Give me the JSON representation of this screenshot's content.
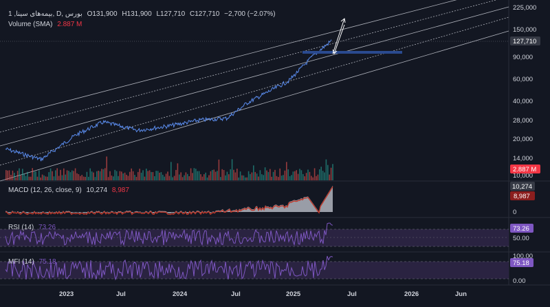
{
  "header": {
    "symbol": "1 ,بیمه‌های سینا, D, بورس",
    "open": "O131,900",
    "high": "H131,900",
    "low": "L127,710",
    "close": "C127,710",
    "change": "−2,700 (−2.07%)",
    "volume_label": "Volume (SMA)",
    "volume_value": "2.887 M"
  },
  "price_axis": {
    "ticks": [
      "225,000",
      "150,000",
      "90,000",
      "60,000",
      "40,000",
      "28,000",
      "20,000",
      "14,000",
      "10,000"
    ],
    "last_price": "127,710",
    "volume_badge": "2.887 M"
  },
  "macd": {
    "label": "MACD (12, 26, close, 9)",
    "value1": "10,274",
    "value2": "8,987",
    "axis_zero": "0",
    "badge1": "10,274",
    "badge2": "8,987"
  },
  "rsi": {
    "label": "RSI (14)",
    "value": "73.26",
    "badge": "73.26",
    "axis_tick": "50.00"
  },
  "mfi": {
    "label": "MFI (14)",
    "value": "75.18",
    "badge": "75.18",
    "axis_top": "100.00",
    "axis_bottom": "0.00"
  },
  "time_axis": [
    "2023",
    "Jul",
    "2024",
    "Jul",
    "2025",
    "Jul",
    "2026",
    "Jun"
  ],
  "colors": {
    "background": "#131722",
    "price_line": "#5b8def",
    "channel": "#b2b5be",
    "macd_fill": "#b2b5be",
    "macd_signal": "#c0392b",
    "oscillator": "#7e57c2",
    "band": "#2a2341",
    "last_price_badge": "#363a45",
    "volume_badge": "#f23645",
    "rsi_badge": "#7e57c2",
    "horizontal_level": "#2a4a8f"
  },
  "chart_data": {
    "type": "line",
    "title": "",
    "xlabel": "",
    "ylabel": "",
    "log_scale": true,
    "ylim": [
      10000,
      225000
    ],
    "x": [
      "2022-11",
      "2023-01",
      "2023-04",
      "2023-07",
      "2023-10",
      "2024-01",
      "2024-04",
      "2024-07",
      "2024-10",
      "2025-01",
      "2025-03",
      "2025-05"
    ],
    "series": [
      {
        "values": [
          17000,
          14000,
          22000,
          28000,
          24000,
          26000,
          29000,
          30000,
          40000,
          60000,
          95000,
          127710
        ]
      }
    ],
    "grid": false
  }
}
